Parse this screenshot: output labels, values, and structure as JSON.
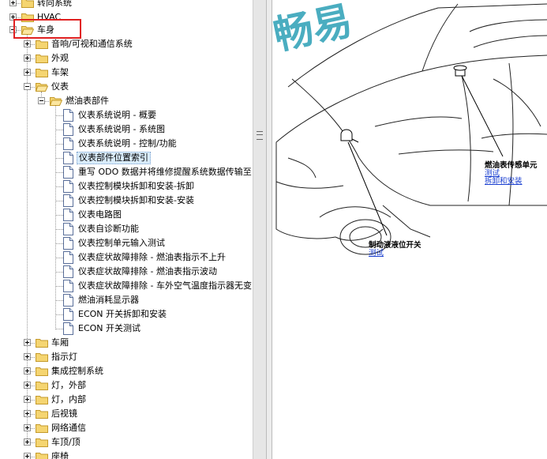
{
  "tree": {
    "items": [
      {
        "label": "转向系统"
      },
      {
        "label": "HVAC"
      },
      {
        "label": "车身"
      },
      {
        "label": "音响/可视和通信系统"
      },
      {
        "label": "外观"
      },
      {
        "label": "车架"
      },
      {
        "label": "仪表"
      },
      {
        "label": "燃油表部件"
      },
      {
        "label": "仪表系统说明 - 概要"
      },
      {
        "label": "仪表系统说明 - 系统图"
      },
      {
        "label": "仪表系统说明 - 控制/功能"
      },
      {
        "label": "仪表部件位置索引"
      },
      {
        "label": "重写 ODO 数据并将维修提醒系统数据传输至"
      },
      {
        "label": "仪表控制模块拆卸和安装-拆卸"
      },
      {
        "label": "仪表控制模块拆卸和安装-安装"
      },
      {
        "label": "仪表电路图"
      },
      {
        "label": "仪表自诊断功能"
      },
      {
        "label": "仪表控制单元输入测试"
      },
      {
        "label": "仪表症状故障排除 - 燃油表指示不上升"
      },
      {
        "label": "仪表症状故障排除 - 燃油表指示波动"
      },
      {
        "label": "仪表症状故障排除 - 车外空气温度指示器无变"
      },
      {
        "label": "燃油消耗显示器"
      },
      {
        "label": "ECON 开关拆卸和安装"
      },
      {
        "label": "ECON 开关测试"
      },
      {
        "label": "车厢"
      },
      {
        "label": "指示灯"
      },
      {
        "label": "集成控制系统"
      },
      {
        "label": "灯，外部"
      },
      {
        "label": "灯，内部"
      },
      {
        "label": "后视镜"
      },
      {
        "label": "网络通信"
      },
      {
        "label": "车顶/顶"
      },
      {
        "label": "座椅"
      }
    ]
  },
  "diagram": {
    "watermark": "畅易",
    "callout_right": {
      "title": "燃油表传感单元",
      "link1": "测试",
      "link2": "拆卸和安装"
    },
    "callout_bottom": {
      "title": "制动液液位开关",
      "link1": "测试"
    }
  },
  "colors": {
    "highlight": "#e02020",
    "selected_bg": "#d9ecfb",
    "link": "#1a3fd0",
    "watermark": "#2a9fb5"
  }
}
